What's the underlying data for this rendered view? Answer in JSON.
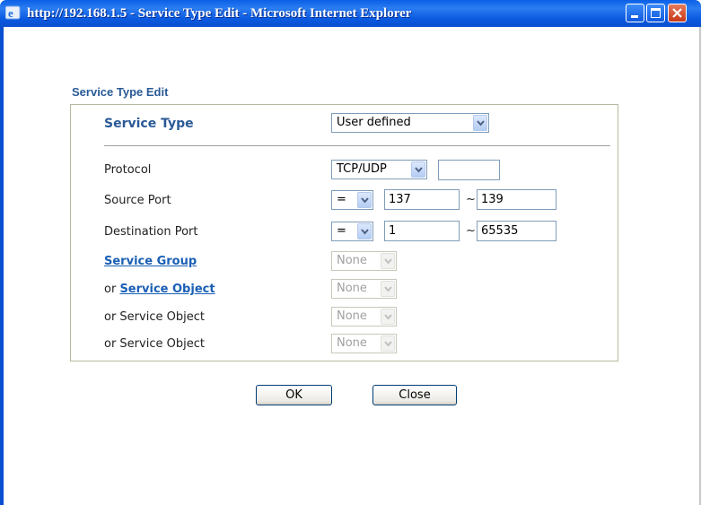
{
  "window": {
    "title": "http://192.168.1.5 - Service Type Edit - Microsoft Internet Explorer"
  },
  "page": {
    "section_title": "Service Type Edit"
  },
  "form": {
    "service_type": {
      "label": "Service Type",
      "value": "User defined"
    },
    "protocol": {
      "label": "Protocol",
      "value": "TCP/UDP",
      "number": ""
    },
    "source_port": {
      "label": "Source Port",
      "operator": "=",
      "start": "137",
      "separator": "~",
      "end": "139"
    },
    "destination_port": {
      "label": "Destination Port",
      "operator": "=",
      "start": "1",
      "separator": "~",
      "end": "65535"
    },
    "service_group": {
      "label": "Service Group",
      "value": "None"
    },
    "service_object_1": {
      "prefix": "or ",
      "label": "Service Object",
      "value": "None"
    },
    "service_object_2": {
      "label": "or Service Object",
      "value": "None"
    },
    "service_object_3": {
      "label": "or Service Object",
      "value": "None"
    }
  },
  "buttons": {
    "ok": "OK",
    "close": "Close"
  },
  "colors": {
    "title_bar": "#0a5fe6",
    "heading": "#2a5a96",
    "link": "#1a5fb4"
  },
  "icons": [
    "ie-icon",
    "minimize-icon",
    "maximize-icon",
    "close-icon",
    "dropdown-arrow-icon"
  ]
}
